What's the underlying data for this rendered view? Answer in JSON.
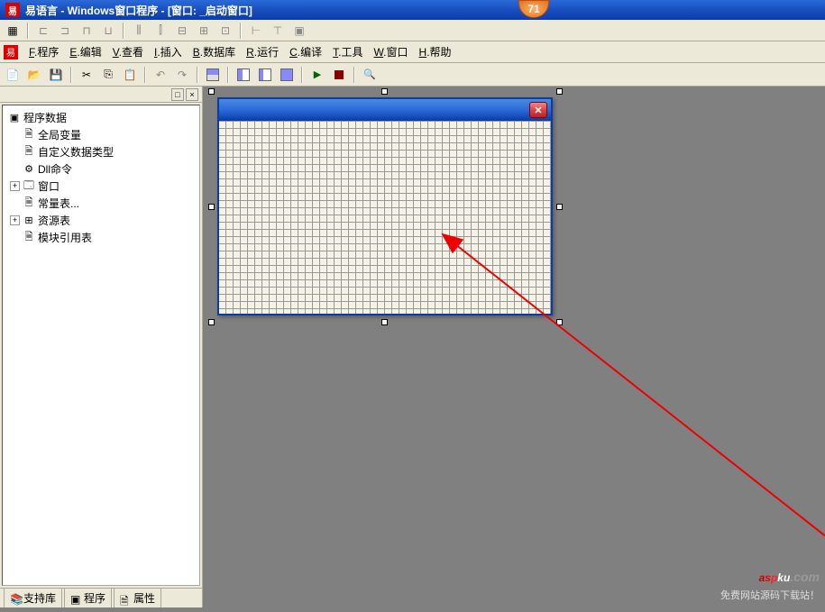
{
  "window": {
    "title": "易语言 - Windows窗口程序 - [窗口: _启动窗口]"
  },
  "badge": {
    "value": "71"
  },
  "menu": [
    {
      "key": "F",
      "label": "程序"
    },
    {
      "key": "E",
      "label": "编辑"
    },
    {
      "key": "V",
      "label": "查看"
    },
    {
      "key": "I",
      "label": "插入"
    },
    {
      "key": "B",
      "label": "数据库"
    },
    {
      "key": "R",
      "label": "运行"
    },
    {
      "key": "C",
      "label": "编译"
    },
    {
      "key": "T",
      "label": "工具"
    },
    {
      "key": "W",
      "label": "窗口"
    },
    {
      "key": "H",
      "label": "帮助"
    }
  ],
  "tree": {
    "root": "程序数据",
    "items": [
      {
        "icon": "var",
        "label": "全局变量"
      },
      {
        "icon": "type",
        "label": "自定义数据类型"
      },
      {
        "icon": "dll",
        "label": "Dll命令"
      },
      {
        "icon": "win",
        "label": "窗口",
        "expandable": true
      },
      {
        "icon": "const",
        "label": "常量表..."
      },
      {
        "icon": "res",
        "label": "资源表",
        "expandable": true
      },
      {
        "icon": "mod",
        "label": "模块引用表"
      }
    ]
  },
  "bottom_tabs": [
    {
      "label": "支持库"
    },
    {
      "label": "程序"
    },
    {
      "label": "属性"
    }
  ],
  "watermark": {
    "brand": "aspku.com",
    "sub": "免费网站源码下载站！"
  }
}
